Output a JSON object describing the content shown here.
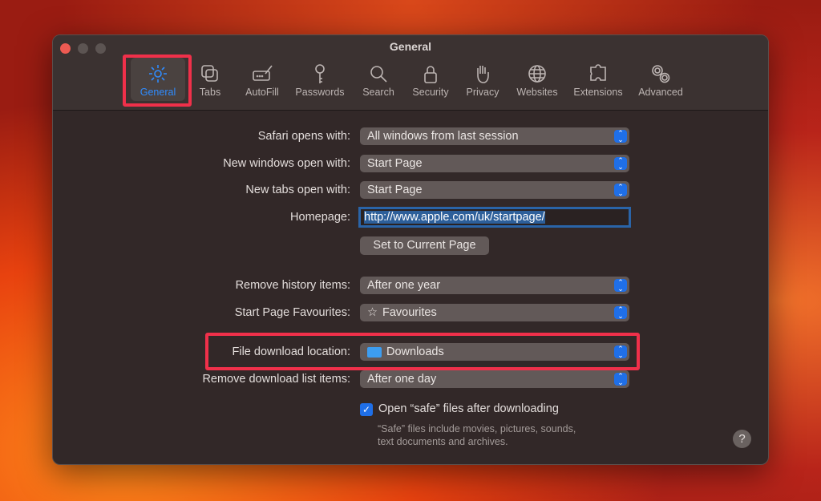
{
  "window": {
    "title": "General"
  },
  "toolbar": [
    {
      "label": "General",
      "icon": "gear-icon"
    },
    {
      "label": "Tabs",
      "icon": "tabs-icon"
    },
    {
      "label": "AutoFill",
      "icon": "autofill-icon"
    },
    {
      "label": "Passwords",
      "icon": "key-icon"
    },
    {
      "label": "Search",
      "icon": "search-icon"
    },
    {
      "label": "Security",
      "icon": "lock-icon"
    },
    {
      "label": "Privacy",
      "icon": "hand-icon"
    },
    {
      "label": "Websites",
      "icon": "globe-icon"
    },
    {
      "label": "Extensions",
      "icon": "puzzle-icon"
    },
    {
      "label": "Advanced",
      "icon": "gears-icon"
    }
  ],
  "settings": {
    "safari_opens": {
      "label": "Safari opens with:",
      "value": "All windows from last session"
    },
    "new_windows": {
      "label": "New windows open with:",
      "value": "Start Page"
    },
    "new_tabs": {
      "label": "New tabs open with:",
      "value": "Start Page"
    },
    "homepage": {
      "label": "Homepage:",
      "value": "http://www.apple.com/uk/startpage/"
    },
    "set_current": "Set to Current Page",
    "remove_history": {
      "label": "Remove history items:",
      "value": "After one year"
    },
    "favourites": {
      "label": "Start Page Favourites:",
      "value": "Favourites"
    },
    "download_location": {
      "label": "File download location:",
      "value": "Downloads"
    },
    "remove_downloads": {
      "label": "Remove download list items:",
      "value": "After one day"
    },
    "open_safe": {
      "label": "Open “safe” files after downloading",
      "checked": true
    },
    "safe_help1": "“Safe” files include movies, pictures, sounds,",
    "safe_help2": "text documents and archives.",
    "help": "?"
  },
  "colors": {
    "accent": "#2f8cff",
    "highlight": "#f0304a"
  }
}
